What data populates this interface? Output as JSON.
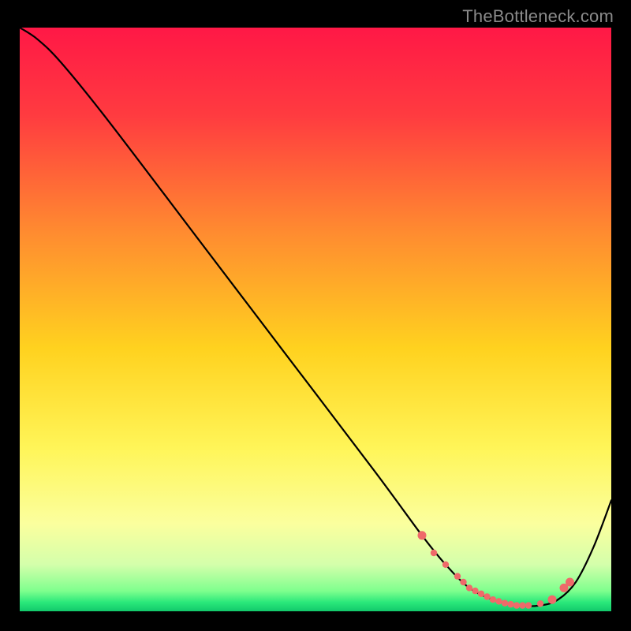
{
  "watermark": "TheBottleneck.com",
  "chart_data": {
    "type": "line",
    "title": "",
    "xlabel": "",
    "ylabel": "",
    "xlim": [
      0,
      100
    ],
    "ylim": [
      0,
      100
    ],
    "background_gradient": {
      "stops": [
        {
          "pos": 0.0,
          "color": "#ff1846"
        },
        {
          "pos": 0.15,
          "color": "#ff3b40"
        },
        {
          "pos": 0.35,
          "color": "#ff8b30"
        },
        {
          "pos": 0.55,
          "color": "#ffd21f"
        },
        {
          "pos": 0.72,
          "color": "#fff558"
        },
        {
          "pos": 0.85,
          "color": "#fbff9e"
        },
        {
          "pos": 0.92,
          "color": "#d4ffab"
        },
        {
          "pos": 0.965,
          "color": "#7fff8e"
        },
        {
          "pos": 0.985,
          "color": "#29e87a"
        },
        {
          "pos": 1.0,
          "color": "#12c96b"
        }
      ]
    },
    "series": [
      {
        "name": "bottleneck-curve",
        "color": "#000000",
        "x": [
          0,
          3,
          7,
          15,
          30,
          45,
          60,
          68,
          72,
          76,
          80,
          84,
          88,
          91,
          94,
          97,
          100
        ],
        "y": [
          100,
          98,
          94,
          84,
          64,
          44,
          24,
          13,
          8,
          4,
          2,
          1,
          1,
          2,
          5,
          11,
          19
        ]
      }
    ],
    "markers": {
      "name": "highlight-points",
      "color": "#ef6a6a",
      "x": [
        68,
        70,
        72,
        74,
        75,
        76,
        77,
        78,
        79,
        80,
        81,
        82,
        83,
        84,
        85,
        86,
        88,
        90,
        92,
        93
      ],
      "y": [
        13,
        10,
        8,
        6,
        5,
        4,
        3.5,
        3,
        2.5,
        2,
        1.7,
        1.4,
        1.2,
        1,
        1,
        1,
        1.3,
        2,
        4,
        5
      ]
    }
  }
}
